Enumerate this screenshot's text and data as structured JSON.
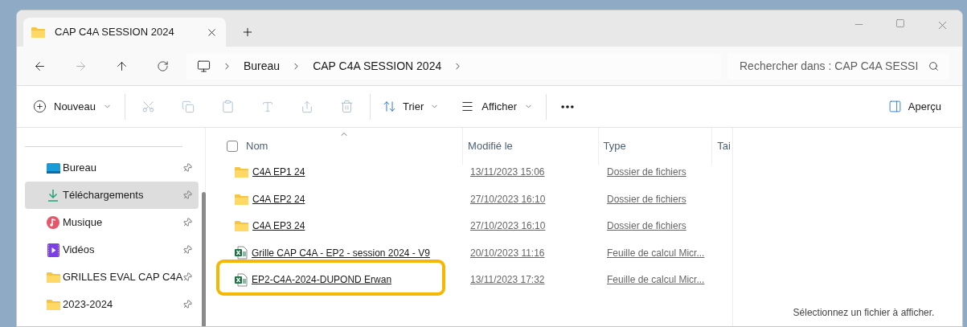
{
  "tab": {
    "title": "CAP C4A SESSION 2024",
    "selected": true
  },
  "address": {
    "crumbs": [
      "Bureau",
      "CAP C4A SESSION 2024"
    ]
  },
  "search": {
    "placeholder": "Rechercher dans : CAP C4A SESSI"
  },
  "toolbar": {
    "new": "Nouveau",
    "sort": "Trier",
    "view": "Afficher",
    "preview": "Aperçu"
  },
  "sidebar": {
    "items": [
      {
        "label": "Bureau",
        "kind": "desktop",
        "selected": false
      },
      {
        "label": "Téléchargements",
        "kind": "download",
        "selected": true
      },
      {
        "label": "Musique",
        "kind": "music",
        "selected": false
      },
      {
        "label": "Vidéos",
        "kind": "video",
        "selected": false
      },
      {
        "label": "GRILLES EVAL CAP C4A",
        "kind": "folder",
        "selected": false
      },
      {
        "label": "2023-2024",
        "kind": "folder",
        "selected": false
      }
    ]
  },
  "table": {
    "select_all": {
      "checked": false
    },
    "columns": [
      "Nom",
      "Modifié le",
      "Type",
      "Tai"
    ],
    "rows": [
      {
        "kind": "folder",
        "name": "C4A EP1 24",
        "modified": "13/11/2023 15:06",
        "type": "Dossier de fichiers",
        "highlighted": false
      },
      {
        "kind": "folder",
        "name": "C4A EP2 24",
        "modified": "27/10/2023 16:10",
        "type": "Dossier de fichiers",
        "highlighted": false
      },
      {
        "kind": "folder",
        "name": "C4A EP3 24",
        "modified": "27/10/2023 16:10",
        "type": "Dossier de fichiers",
        "highlighted": false
      },
      {
        "kind": "sheet",
        "name": "Grille CAP C4A - EP2 - session 2024 - V9",
        "modified": "20/10/2023 11:16",
        "type": "Feuille de calcul Micr...",
        "highlighted": false
      },
      {
        "kind": "sheet",
        "name": "EP2-C4A-2024-DUPOND Erwan",
        "modified": "13/11/2023 17:32",
        "type": "Feuille de calcul Micr...",
        "highlighted": true
      }
    ]
  },
  "preview_pane": {
    "message": "Sélectionnez un fichier à afficher."
  }
}
